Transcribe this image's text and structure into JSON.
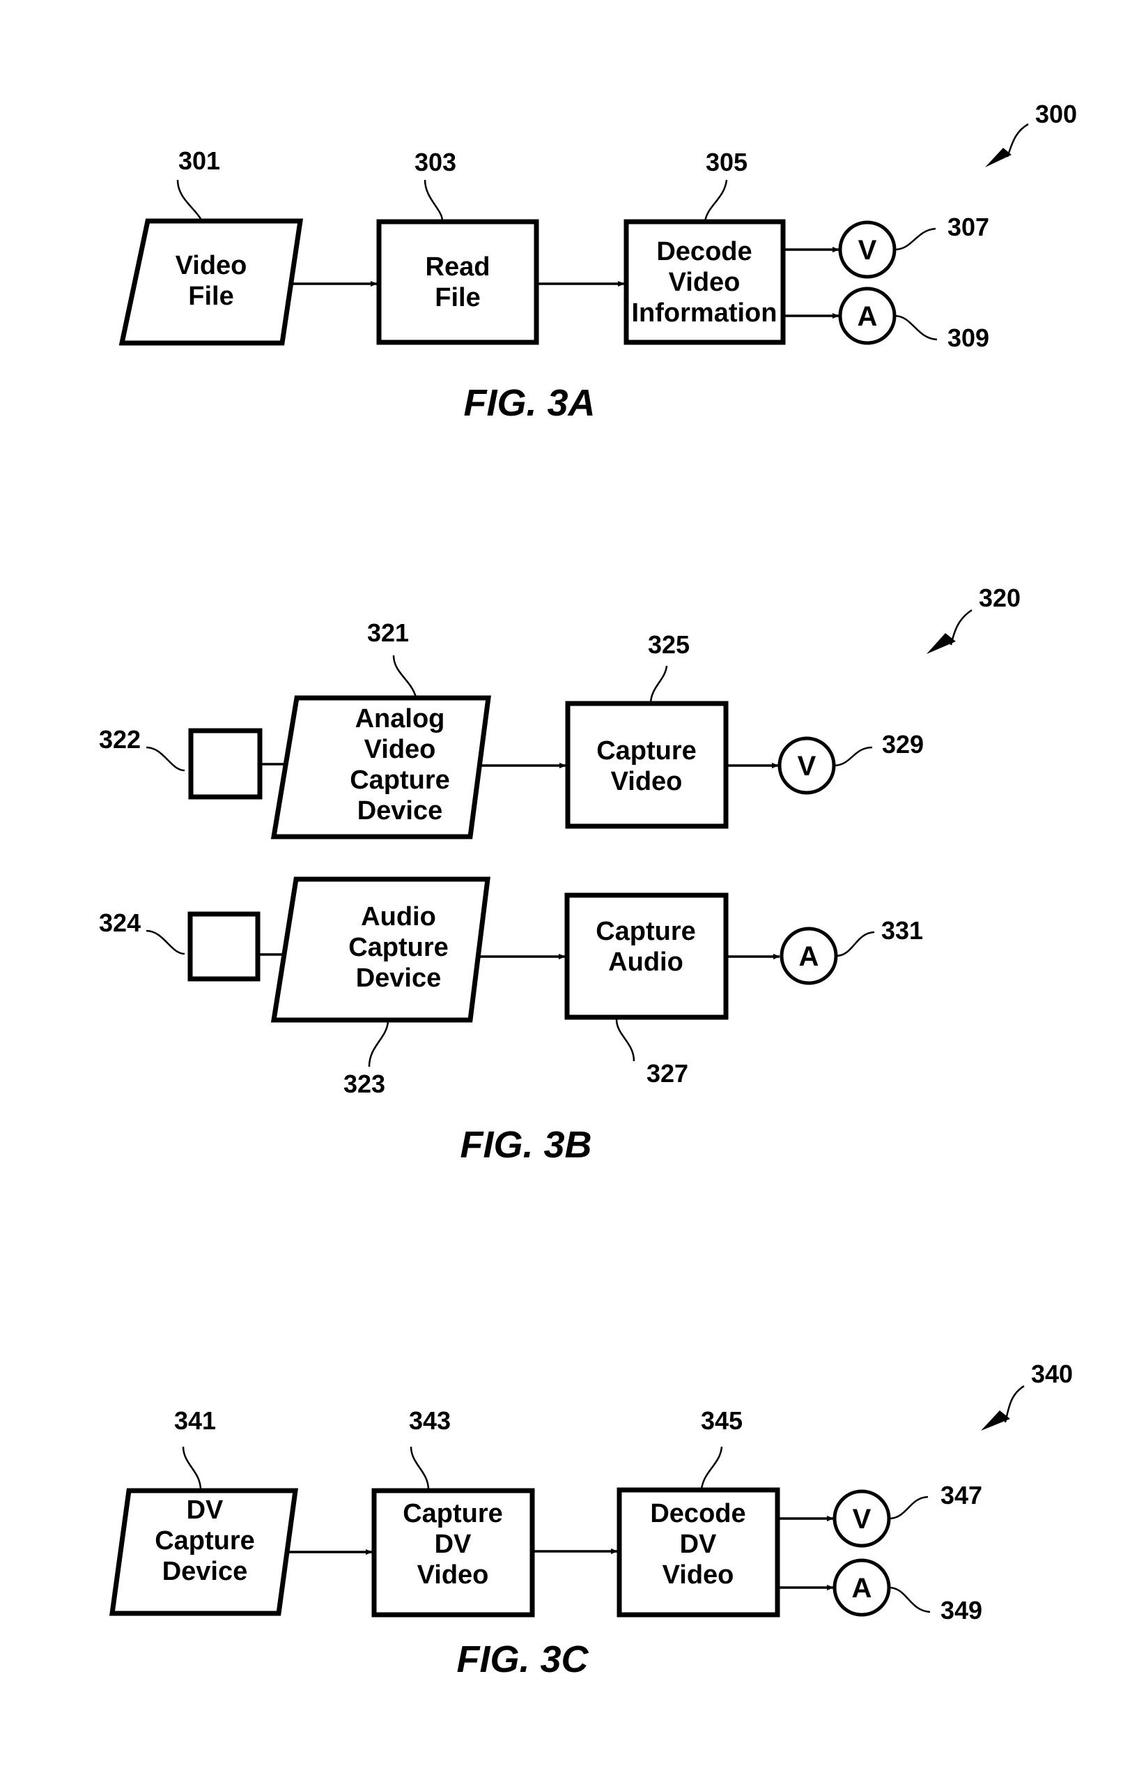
{
  "figures": [
    {
      "id": "3A",
      "caption": "FIG. 3A",
      "ref": "300",
      "nodes": {
        "video_file": {
          "ref": "301",
          "lines": [
            "Video",
            "File"
          ],
          "shape": "parallelogram"
        },
        "read_file": {
          "ref": "303",
          "lines": [
            "Read",
            "File"
          ],
          "shape": "rectangle"
        },
        "decode": {
          "ref": "305",
          "lines": [
            "Decode",
            "Video",
            "Information"
          ],
          "shape": "rectangle"
        },
        "video_out": {
          "ref": "307",
          "label": "V",
          "shape": "circle"
        },
        "audio_out": {
          "ref": "309",
          "label": "A",
          "shape": "circle"
        }
      },
      "edges": [
        [
          "video_file",
          "read_file"
        ],
        [
          "read_file",
          "decode"
        ],
        [
          "decode",
          "video_out"
        ],
        [
          "decode",
          "audio_out"
        ]
      ]
    },
    {
      "id": "3B",
      "caption": "FIG. 3B",
      "ref": "320",
      "nodes": {
        "video_source": {
          "ref": "322",
          "lines": [],
          "shape": "rectangle"
        },
        "analog_capture": {
          "ref": "321",
          "lines": [
            "Analog",
            "Video",
            "Capture",
            "Device"
          ],
          "shape": "parallelogram"
        },
        "capture_video": {
          "ref": "325",
          "lines": [
            "Capture",
            "Video"
          ],
          "shape": "rectangle"
        },
        "video_out": {
          "ref": "329",
          "label": "V",
          "shape": "circle"
        },
        "audio_source": {
          "ref": "324",
          "lines": [],
          "shape": "rectangle"
        },
        "audio_capture": {
          "ref": "323",
          "lines": [
            "Audio",
            "Capture",
            "Device"
          ],
          "shape": "parallelogram"
        },
        "capture_audio": {
          "ref": "327",
          "lines": [
            "Capture",
            "Audio"
          ],
          "shape": "rectangle"
        },
        "audio_out": {
          "ref": "331",
          "label": "A",
          "shape": "circle"
        }
      },
      "edges": [
        [
          "video_source",
          "analog_capture"
        ],
        [
          "analog_capture",
          "capture_video"
        ],
        [
          "capture_video",
          "video_out"
        ],
        [
          "audio_source",
          "audio_capture"
        ],
        [
          "audio_capture",
          "capture_audio"
        ],
        [
          "capture_audio",
          "audio_out"
        ]
      ]
    },
    {
      "id": "3C",
      "caption": "FIG. 3C",
      "ref": "340",
      "nodes": {
        "dv_capture": {
          "ref": "341",
          "lines": [
            "DV",
            "Capture",
            "Device"
          ],
          "shape": "parallelogram"
        },
        "capture_dv": {
          "ref": "343",
          "lines": [
            "Capture",
            "DV",
            "Video"
          ],
          "shape": "rectangle"
        },
        "decode_dv": {
          "ref": "345",
          "lines": [
            "Decode",
            "DV",
            "Video"
          ],
          "shape": "rectangle"
        },
        "video_out": {
          "ref": "347",
          "label": "V",
          "shape": "circle"
        },
        "audio_out": {
          "ref": "349",
          "label": "A",
          "shape": "circle"
        }
      },
      "edges": [
        [
          "dv_capture",
          "capture_dv"
        ],
        [
          "capture_dv",
          "decode_dv"
        ],
        [
          "decode_dv",
          "video_out"
        ],
        [
          "decode_dv",
          "audio_out"
        ]
      ]
    }
  ]
}
